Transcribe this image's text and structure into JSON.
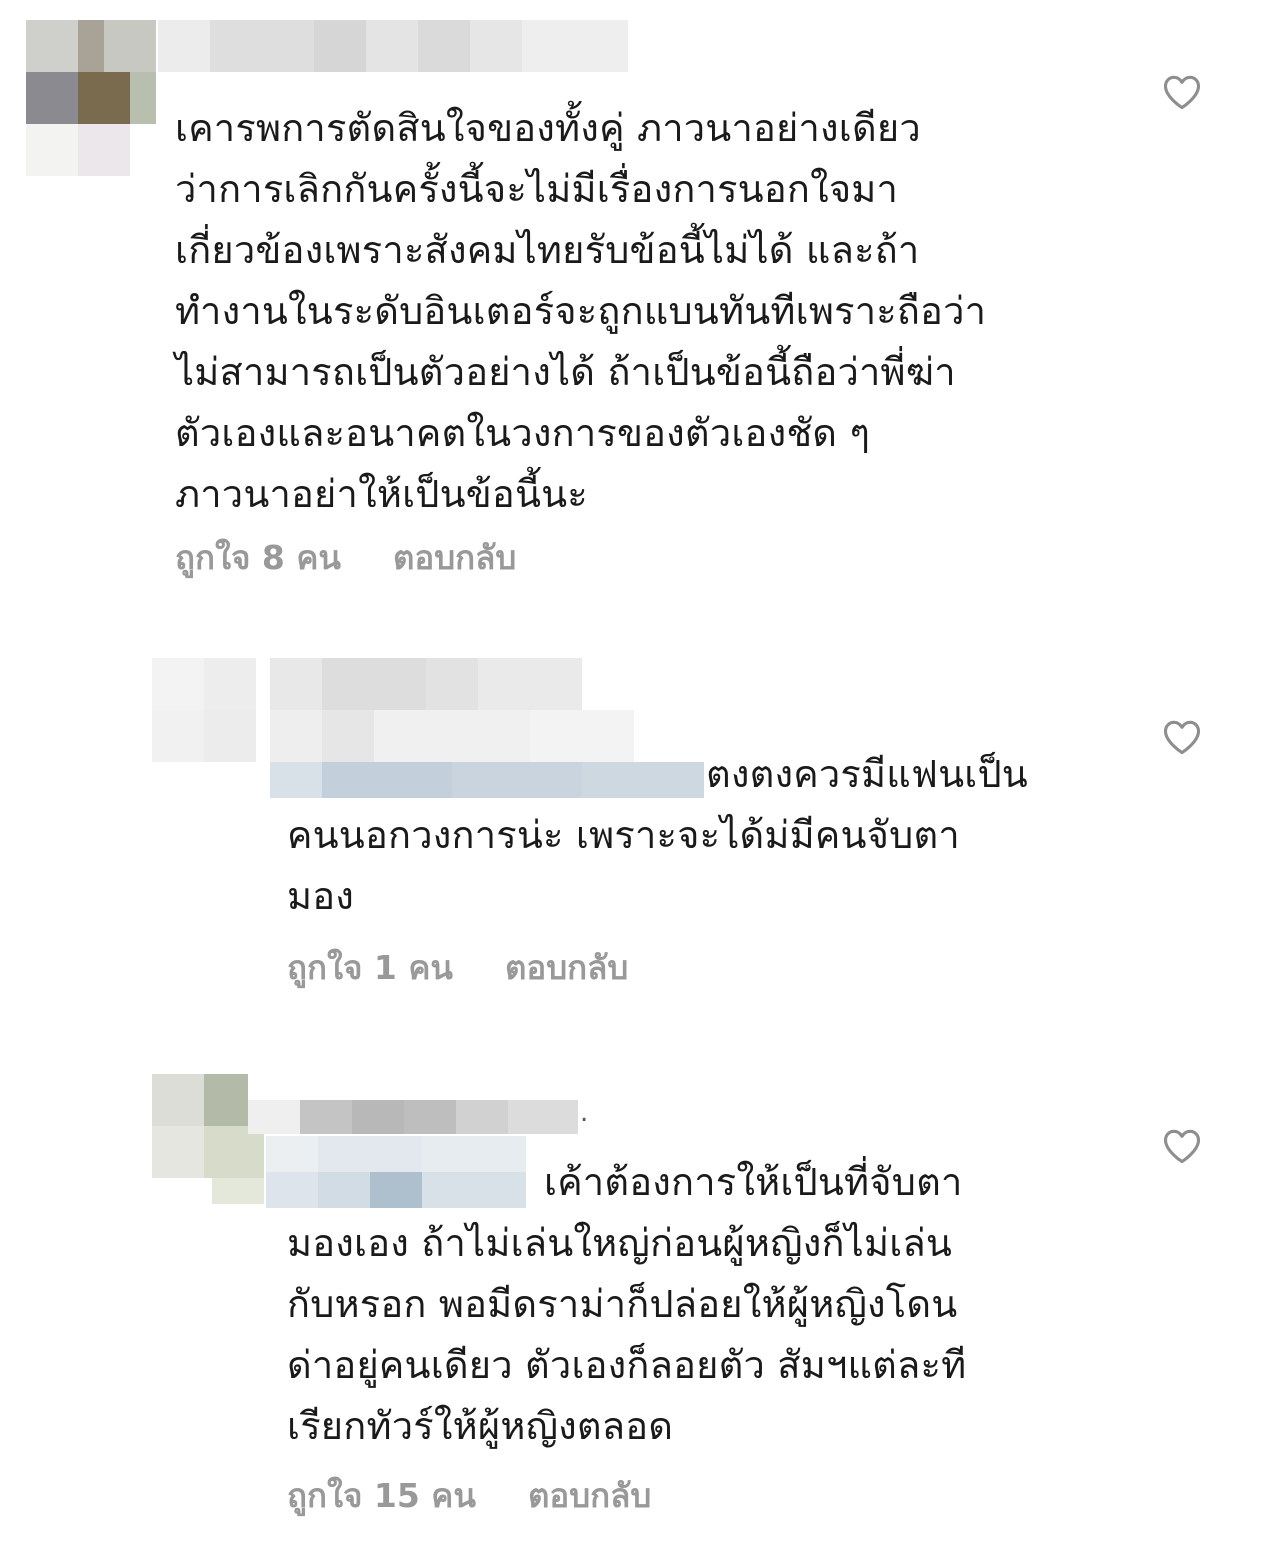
{
  "comments": [
    {
      "text": "เคารพการตัดสินใจของทั้งคู่ ภาวนาอย่างเดียว\nว่าการเลิกกันครั้งนี้จะไม่มีเรื่องการนอกใจมา\nเกี่ยวข้องเพราะสังคมไทยรับข้อนี้ไม่ได้ และถ้า\nทำงานในระดับอินเตอร์จะถูกแบนทันทีเพราะถือว่า\nไม่สามารถเป็นตัวอย่างได้ ถ้าเป็นข้อนี้ถือว่าพี่ฆ่า\nตัวเองและอนาคตในวงการของตัวเองชัด ๆ\nภาวนาอย่าให้เป็นข้อนี้นะ",
      "likes": "ถูกใจ 8 คน",
      "reply": "ตอบกลับ"
    },
    {
      "text_first": "ตงตงควรมีแฟนเป็น",
      "text_rest": "คนนอกวงการน่ะ เพราะจะได้ม่มีคนจับตา\nมอง",
      "likes": "ถูกใจ 1 คน",
      "reply": "ตอบกลับ"
    },
    {
      "username_tail": ".",
      "text_first": "เค้าต้องการให้เป็นที่จับตา",
      "text_rest": "มองเอง ถ้าไม่เล่นใหญ่ก่อนผู้หญิงก็ไม่เล่น\nกับหรอก พอมีดราม่าก็ปล่อยให้ผู้หญิงโดน\nด่าอยู่คนเดียว ตัวเองก็ลอยตัว สัมฯแต่ละที\nเรียกทัวร์ให้ผู้หญิงตลอด",
      "likes": "ถูกใจ 15 คน",
      "reply": "ตอบกลับ"
    }
  ],
  "icons": {
    "like": "heart-outline-icon"
  }
}
